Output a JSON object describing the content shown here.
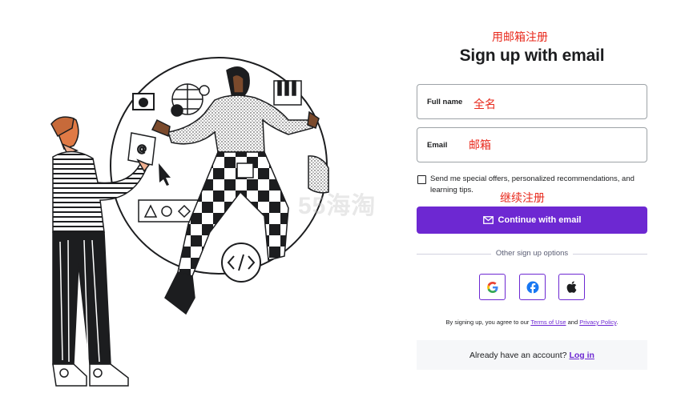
{
  "annotations": {
    "email_signup": "用邮箱注册",
    "full_name": "全名",
    "email": "邮箱",
    "continue": "继续注册"
  },
  "header": {
    "title": "Sign up with email"
  },
  "form": {
    "full_name_label": "Full name",
    "email_label": "Email",
    "offers_checkbox_label": "Send me special offers, personalized recommendations, and learning tips.",
    "continue_label": "Continue with email"
  },
  "other_options": {
    "divider_text": "Other sign up options",
    "providers": [
      "google-icon",
      "facebook-icon",
      "apple-icon"
    ]
  },
  "terms": {
    "prefix": "By signing up, you agree to our",
    "terms_link": "Terms of Use",
    "and": "and",
    "privacy_link": "Privacy Policy",
    "suffix": "."
  },
  "login": {
    "prompt": "Already have an account?",
    "link": "Log in"
  },
  "watermark": "55海淘",
  "colors": {
    "accent": "#6d28d2",
    "annotation": "#e8291c",
    "field_border": "#9da3a7"
  }
}
